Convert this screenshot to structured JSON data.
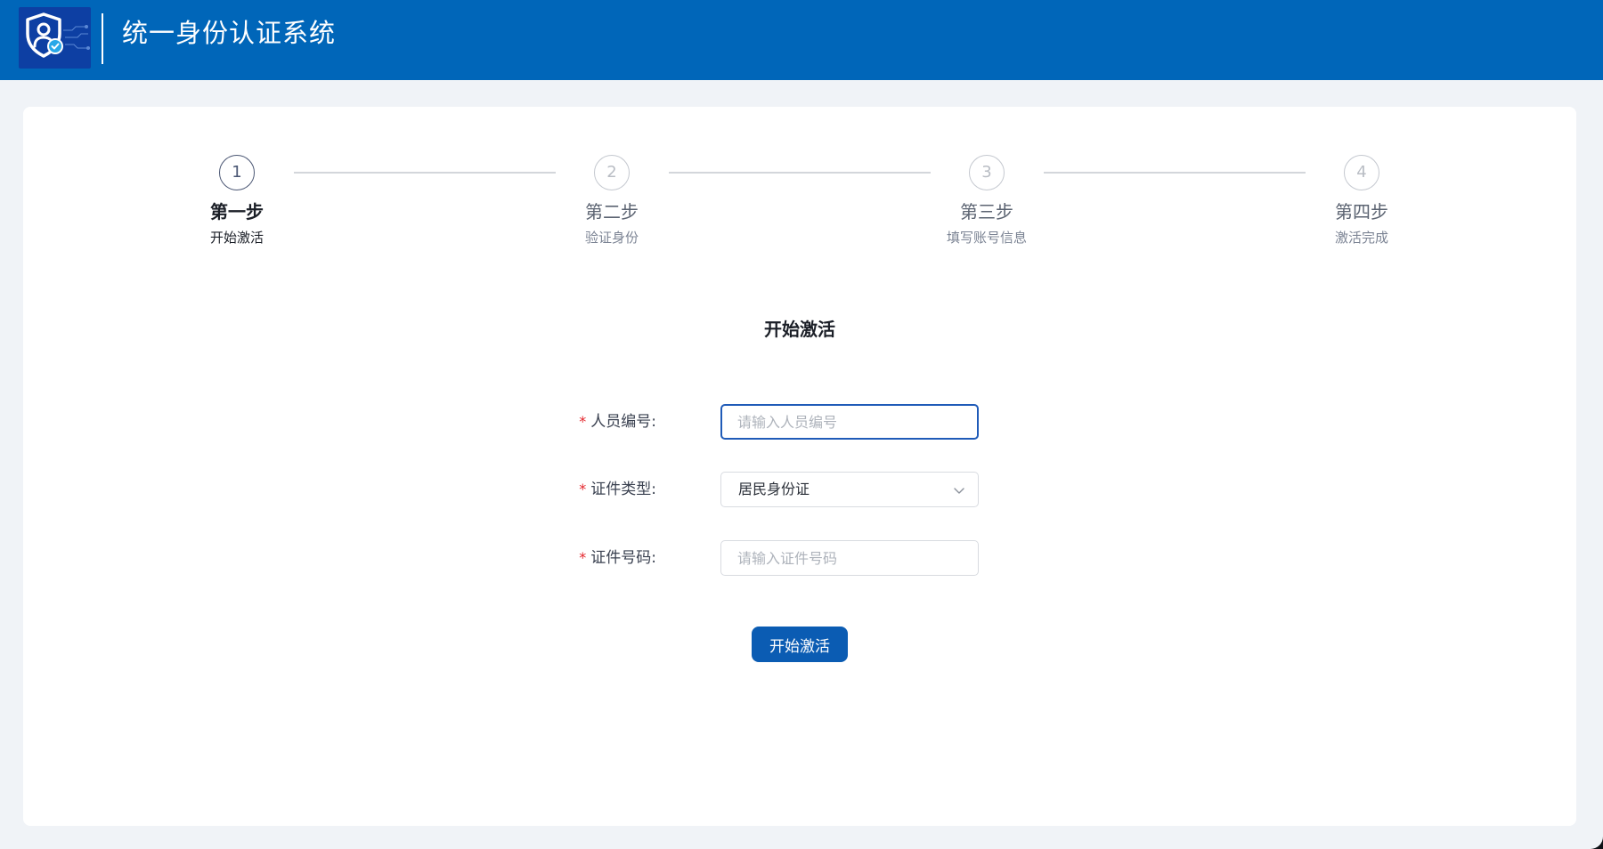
{
  "header": {
    "app_title": "统一身份认证系统"
  },
  "steps": [
    {
      "number": "1",
      "title": "第一步",
      "desc": "开始激活",
      "state": "active"
    },
    {
      "number": "2",
      "title": "第二步",
      "desc": "验证身份",
      "state": "pending"
    },
    {
      "number": "3",
      "title": "第三步",
      "desc": "填写账号信息",
      "state": "pending"
    },
    {
      "number": "4",
      "title": "第四步",
      "desc": "激活完成",
      "state": "pending"
    }
  ],
  "form": {
    "title": "开始激活",
    "required_mark": "*",
    "fields": {
      "personnel_id": {
        "label": "人员编号:",
        "value": "",
        "placeholder": "请输入人员编号"
      },
      "cert_type": {
        "label": "证件类型:",
        "value": "居民身份证"
      },
      "cert_number": {
        "label": "证件号码:",
        "value": "",
        "placeholder": "请输入证件号码"
      }
    },
    "submit_label": "开始激活"
  },
  "colors": {
    "header_bg": "#0066b9",
    "primary": "#0b5cb3",
    "required": "#e4252b",
    "page_bg": "#f0f3f7"
  },
  "icons": {
    "logo": "shield-user-check-icon",
    "select_arrow": "chevron-down-icon"
  }
}
